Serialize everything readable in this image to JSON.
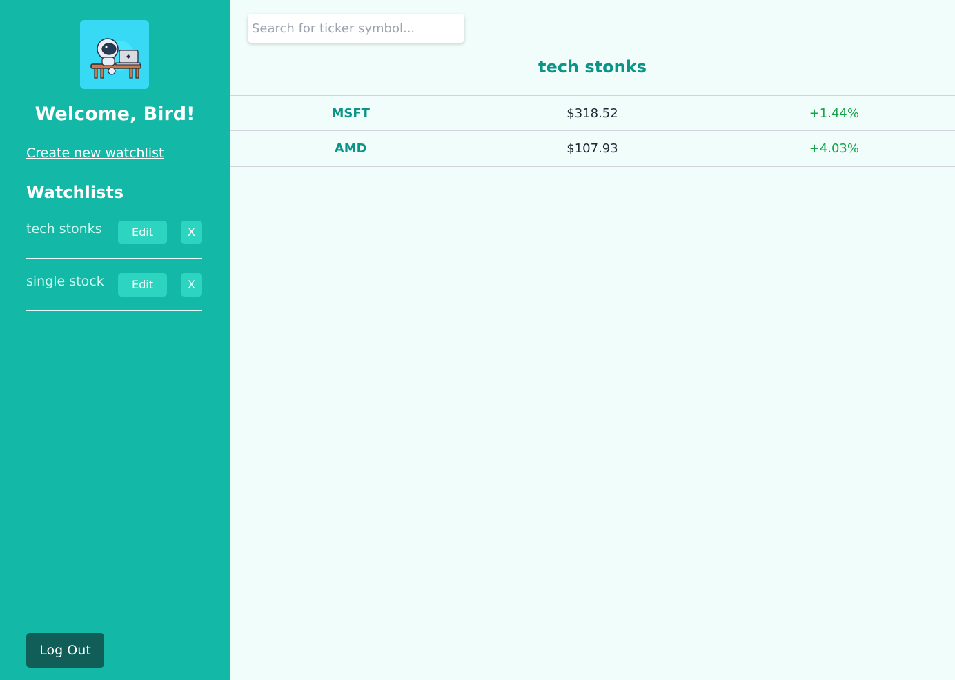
{
  "sidebar": {
    "welcome": "Welcome, Bird!",
    "create_link": "Create new watchlist",
    "watchlists_heading": "Watchlists",
    "watchlists": [
      {
        "name": "tech stonks",
        "edit_label": "Edit",
        "delete_label": "X"
      },
      {
        "name": "single stock",
        "edit_label": "Edit",
        "delete_label": "X"
      }
    ],
    "logout_label": "Log Out"
  },
  "search": {
    "placeholder": "Search for ticker symbol..."
  },
  "main": {
    "title": "tech stonks",
    "stocks": [
      {
        "symbol": "MSFT",
        "price": "$318.52",
        "change": "+1.44%"
      },
      {
        "symbol": "AMD",
        "price": "$107.93",
        "change": "+4.03%"
      }
    ]
  },
  "colors": {
    "sidebar_bg": "#14b8a6",
    "accent": "#0d9488",
    "positive": "#16a34a",
    "logout_bg": "#115e59",
    "main_bg": "#f0fdfa"
  }
}
